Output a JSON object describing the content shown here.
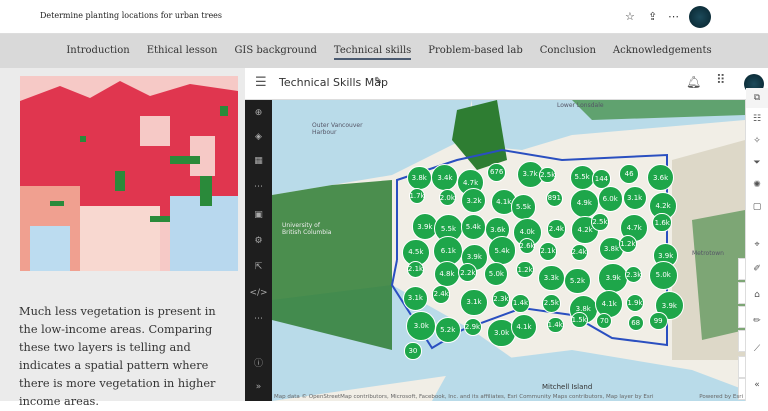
{
  "header": {
    "title": "Determine planting locations for urban trees"
  },
  "nav": {
    "items": [
      "Introduction",
      "Ethical lesson",
      "GIS background",
      "Technical skills",
      "Problem-based lab",
      "Conclusion",
      "Acknowledgements"
    ],
    "active": "Technical skills"
  },
  "left": {
    "paragraph": "Much less vegetation is present in the low-income areas. Comparing these two layers is telling and indicates a spatial pattern where there is more vegetation in higher income areas."
  },
  "app": {
    "title": "Technical Skills Map"
  },
  "map": {
    "labels": {
      "lonsdale": "Lower Lonsdale",
      "harbour": "Outer Vancouver Harbour",
      "mitchell": "Mitchell Island",
      "ubc": "University of British Columbia",
      "melrose": "Metrotown"
    },
    "clusters": [
      "3.8k",
      "3.4k",
      "4.7k",
      "676",
      "3.7k",
      "2.5k",
      "5.5k",
      "144",
      "46",
      "3.6k",
      "1.7k",
      "2.0k",
      "3.2k",
      "4.1k",
      "5.5k",
      "891",
      "4.9k",
      "6.0k",
      "3.1k",
      "4.2k",
      "3.9k",
      "5.5k",
      "5.4k",
      "3.6k",
      "4.0k",
      "2.4k",
      "4.2k",
      "2.5k",
      "4.7k",
      "1.6k",
      "4.5k",
      "6.1k",
      "3.9k",
      "5.4k",
      "2.6k",
      "2.1k",
      "2.4k",
      "3.8k",
      "1.2k",
      "3.9k",
      "2.1k",
      "4.8k",
      "2.2k",
      "5.0k",
      "1.2k",
      "3.3k",
      "5.2k",
      "3.9k",
      "2.3k",
      "5.0k",
      "3.1k",
      "2.4k",
      "3.1k",
      "2.3k",
      "1.4k",
      "2.5k",
      "3.8k",
      "4.1k",
      "1.9k",
      "3.9k",
      "3.0k",
      "5.2k",
      "2.9k",
      "3.0k",
      "4.1k",
      "1.4k",
      "1.5k",
      "70",
      "68",
      "99",
      "30"
    ],
    "attribution": "Map data © OpenStreetMap contributors, Microsoft, Facebook, Inc. and its affiliates, Esri Community Maps contributors, Map layer by Esri",
    "powered": "Powered by Esri"
  },
  "colors": {
    "cluster": "#1ea64a",
    "boundary": "#2a4fc0"
  }
}
